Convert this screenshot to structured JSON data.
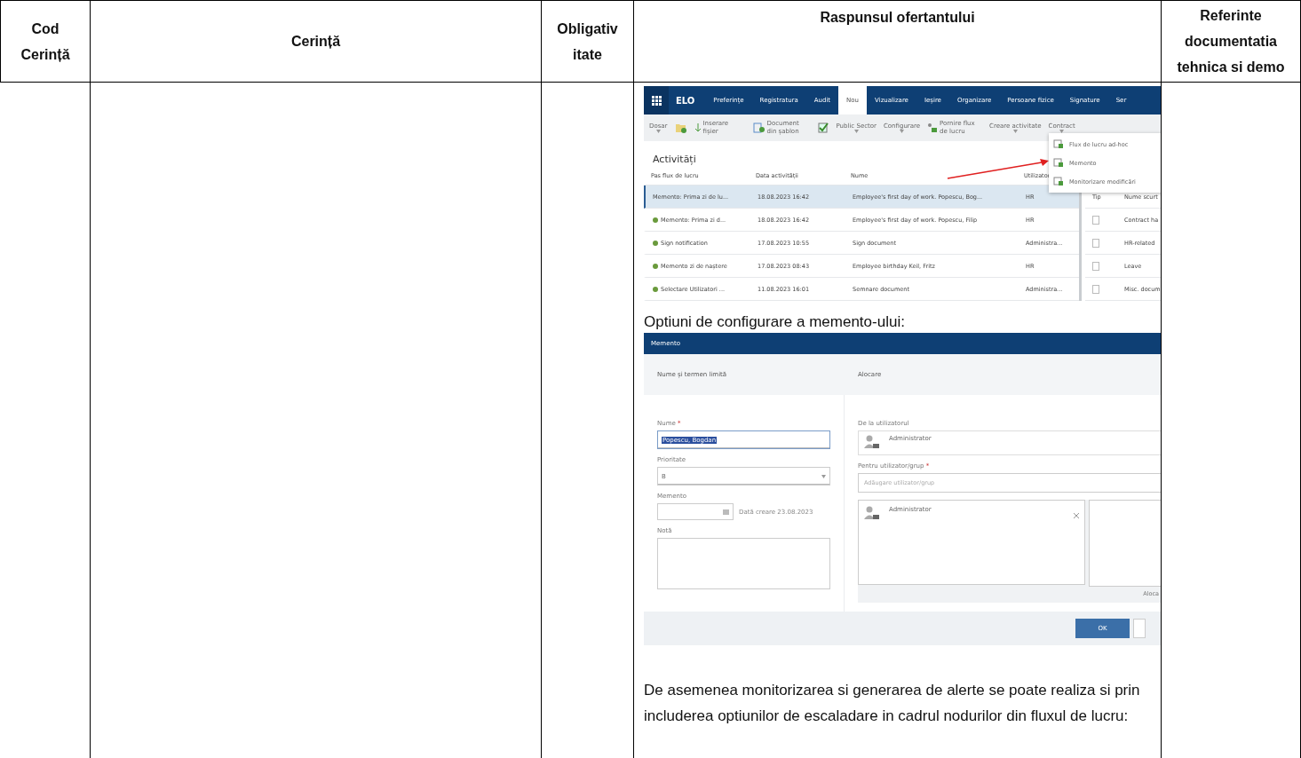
{
  "table": {
    "columns": [
      {
        "lines": [
          "Cod",
          "Cerință"
        ]
      },
      {
        "lines": [
          "Cerință"
        ]
      },
      {
        "lines": [
          "Obligativ",
          "itate"
        ]
      },
      {
        "lines": [
          "Raspunsul ofertantului"
        ]
      },
      {
        "lines": [
          "Referinte",
          "documentatia",
          "tehnica si demo"
        ]
      }
    ]
  },
  "activities_screenshot": {
    "logo": "ELO",
    "tabs": [
      {
        "label": "Preferințe",
        "selected": false
      },
      {
        "label": "Registratura",
        "selected": false
      },
      {
        "label": "Audit",
        "selected": false
      },
      {
        "label": "Nou",
        "selected": true
      },
      {
        "label": "Vizualizare",
        "selected": false
      },
      {
        "label": "Ieșire",
        "selected": false
      },
      {
        "label": "Organizare",
        "selected": false
      },
      {
        "label": "Persoane fizice",
        "selected": false
      },
      {
        "label": "Signature",
        "selected": false
      },
      {
        "label": "Ser",
        "selected": false
      }
    ],
    "ribbon": [
      {
        "kind": "dropdown",
        "label": "Dosar"
      },
      {
        "kind": "icon"
      },
      {
        "kind": "labeled",
        "label": "Inserare fișier"
      },
      {
        "kind": "labeled",
        "label": "Document din șablon"
      },
      {
        "kind": "icon"
      },
      {
        "kind": "dropdown",
        "label": "Public Sector"
      },
      {
        "kind": "dropdown",
        "label": "Configurare"
      },
      {
        "kind": "labeled",
        "label": "Pornire flux de lucru"
      },
      {
        "kind": "dropdown",
        "label": "Creare activitate"
      },
      {
        "kind": "dropdown",
        "label": "Contract"
      }
    ],
    "menu": [
      "Flux de lucru ad-hoc",
      "Memento",
      "Monitorizare modificări"
    ],
    "title": "Activități",
    "columns": [
      "Pas flux de lucru",
      "Data activității",
      "Nume",
      "Utilizator"
    ],
    "rows": [
      {
        "selected": true,
        "cells": [
          "Memento: Prima zi de lu...",
          "18.08.2023 16:42",
          "Employee's first day of work. Popescu, Bog...",
          "HR"
        ]
      },
      {
        "selected": false,
        "cells": [
          "Memento: Prima zi d...",
          "18.08.2023 16:42",
          "Employee's first day of work. Popescu, Filip",
          "HR"
        ]
      },
      {
        "selected": false,
        "cells": [
          "Sign notification",
          "17.08.2023 10:55",
          "Sign document",
          "Administra..."
        ]
      },
      {
        "selected": false,
        "cells": [
          "Memento zi de naștere",
          "17.08.2023 08:43",
          "Employee birthday Keil, Fritz",
          "HR"
        ]
      },
      {
        "selected": false,
        "cells": [
          "Selectare Utilizatori ...",
          "11.08.2023 16:01",
          "Semnare document",
          "Administra..."
        ]
      }
    ],
    "side_columns": [
      "Tip",
      "Nume scurt"
    ],
    "side_rows": [
      "Contract ha",
      "HR-related",
      "Leave",
      "Misc. docum"
    ]
  },
  "caption": "Optiuni de configurare a memento-ului:",
  "memento_dialog": {
    "title": "Memento",
    "left_section": "Nume și termen limită",
    "right_section": "Alocare",
    "name_label": "Nume",
    "name_mark": "*",
    "name_value": "Popescu, Bogdan",
    "priority_label": "Prioritate",
    "priority_value": "B",
    "memento_label": "Memento",
    "created": "Dată creare 23.08.2023",
    "note_label": "Notă",
    "from_label": "De la utilizatorul",
    "from_value": "Administrator",
    "for_label": "Pentru utilizator/grup",
    "for_mark": "*",
    "for_placeholder": "Adăugare utilizator/grup",
    "assigned": "Administrator",
    "assigned_footer": "Aloca",
    "ok": "OK"
  },
  "paragraph": "De asemenea monitorizarea si generarea de alerte se poate realiza si prin includerea optiunilor de escaladare in cadrul nodurilor din fluxul de lucru:"
}
